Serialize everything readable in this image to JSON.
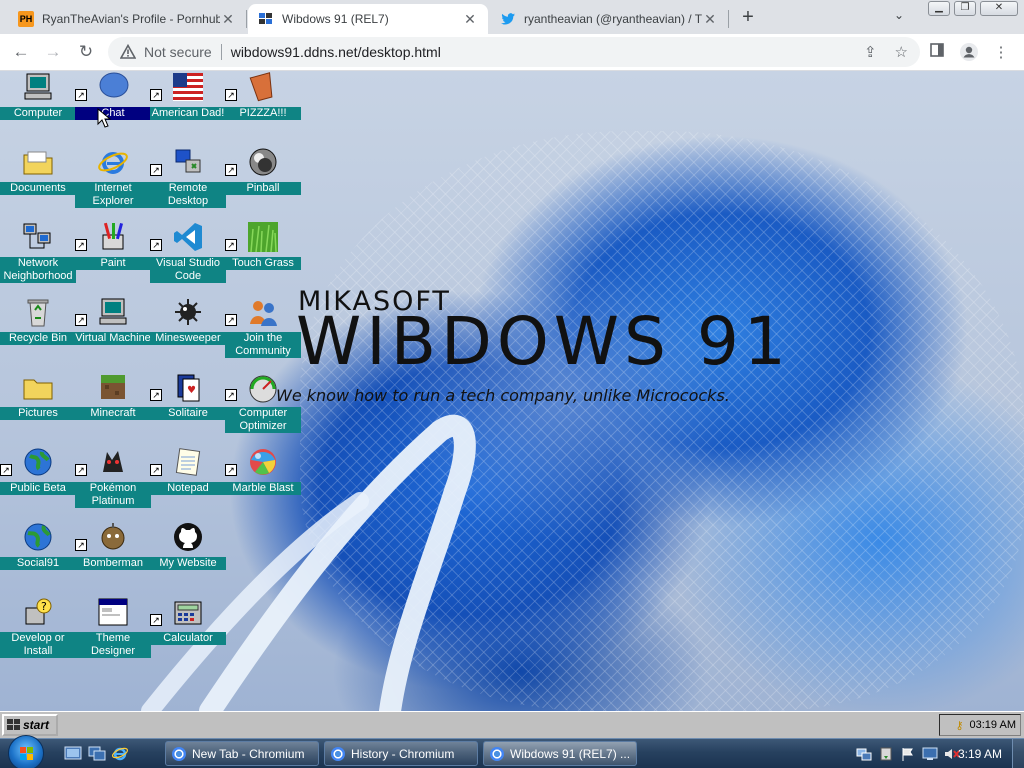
{
  "browser": {
    "tabs": [
      {
        "title": "RyanTheAvian's Profile - Pornhub",
        "favicon": "PH"
      },
      {
        "title": "Wibdows 91 (REL7)",
        "active": true
      },
      {
        "title": "ryantheavian (@ryantheavian) / T"
      }
    ],
    "address": {
      "security": "Not secure",
      "url": "wibdows91.ddns.net/desktop.html"
    }
  },
  "desktop": {
    "brand": {
      "small": "MIKASOFT",
      "big": "WIBDOWS 91",
      "tagline": "We know how to run a tech company, unlike Micrococks."
    },
    "icons": [
      {
        "label": "Computer",
        "icon": "computer-icon"
      },
      {
        "label": "Chat",
        "icon": "chat-bubble-icon"
      },
      {
        "label": "American Dad!",
        "icon": "us-flag-icon"
      },
      {
        "label": "PIZZZA!!!",
        "icon": "pizza-box-icon"
      },
      {
        "label": "Documents",
        "icon": "folder-icon"
      },
      {
        "label": "Internet Explorer",
        "icon": "internet-explorer-icon"
      },
      {
        "label": "Remote Desktop",
        "icon": "remote-desktop-icon"
      },
      {
        "label": "Pinball",
        "icon": "pinball-icon"
      },
      {
        "label": "Network Neighborhood",
        "icon": "network-icon"
      },
      {
        "label": "Paint",
        "icon": "paint-icon"
      },
      {
        "label": "Visual Studio Code",
        "icon": "vscode-icon"
      },
      {
        "label": "Touch Grass",
        "icon": "grass-icon"
      },
      {
        "label": "Recycle Bin",
        "icon": "recycle-bin-icon"
      },
      {
        "label": "Virtual Machine",
        "icon": "computer-icon"
      },
      {
        "label": "Minesweeper",
        "icon": "mine-icon"
      },
      {
        "label": "Join the Community",
        "icon": "community-icon"
      },
      {
        "label": "Pictures",
        "icon": "folder-icon"
      },
      {
        "label": "Minecraft",
        "icon": "minecraft-block-icon"
      },
      {
        "label": "Solitaire",
        "icon": "solitaire-icon"
      },
      {
        "label": "Computer Optimizer",
        "icon": "gauge-icon"
      },
      {
        "label": "Public Beta",
        "icon": "globe-icon"
      },
      {
        "label": "Pokémon Platinum",
        "icon": "pokemon-icon"
      },
      {
        "label": "Notepad",
        "icon": "notepad-icon"
      },
      {
        "label": "Marble Blast",
        "icon": "marble-icon"
      },
      {
        "label": "Social91",
        "icon": "globe-icon"
      },
      {
        "label": "Bomberman",
        "icon": "bomberman-icon"
      },
      {
        "label": "My Website",
        "icon": "github-icon"
      },
      {
        "label": "Develop or Install",
        "icon": "setup-icon"
      },
      {
        "label": "Theme Designer",
        "icon": "window-icon"
      },
      {
        "label": "Calculator",
        "icon": "calculator-icon"
      }
    ]
  },
  "w91_taskbar": {
    "start_label": "start",
    "clock": "03:19 AM"
  },
  "win7_taskbar": {
    "tasks": [
      {
        "label": "New Tab - Chromium"
      },
      {
        "label": "History - Chromium"
      },
      {
        "label": "Wibdows 91 (REL7) ..."
      }
    ],
    "clock": "3:19 AM"
  }
}
